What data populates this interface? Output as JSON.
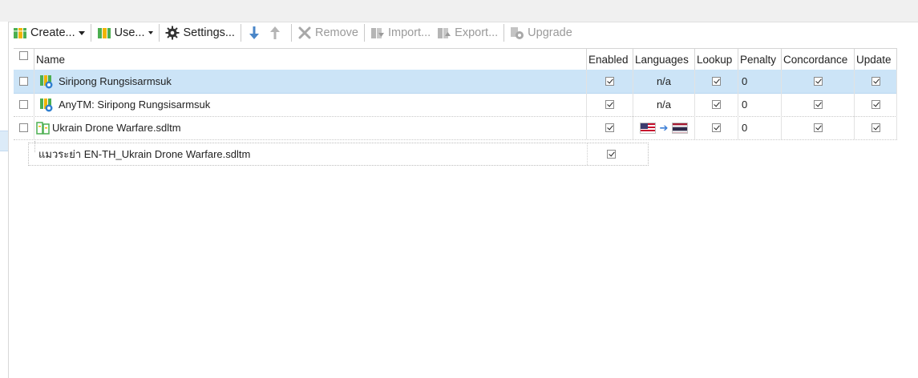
{
  "toolbar": {
    "create_label": "Create...",
    "use_label": "Use...",
    "settings_label": "Settings...",
    "remove_label": "Remove",
    "import_label": "Import...",
    "export_label": "Export...",
    "upgrade_label": "Upgrade"
  },
  "grid": {
    "columns": [
      "Name",
      "Enabled",
      "Languages",
      "Lookup",
      "Penalty",
      "Concordance",
      "Update"
    ],
    "rows": [
      {
        "name": "Siripong Rungsisarmsuk",
        "enabled": true,
        "languages": "n/a",
        "lookup": true,
        "penalty": "0",
        "concordance": true,
        "update": true,
        "selected": true,
        "icon": "server-tm-icon"
      },
      {
        "name": "AnyTM: Siripong Rungsisarmsuk",
        "enabled": true,
        "languages": "n/a",
        "lookup": true,
        "penalty": "0",
        "concordance": true,
        "update": true,
        "selected": false,
        "icon": "server-tm-icon"
      },
      {
        "name": "Ukrain Drone Warfare.sdltm",
        "enabled": true,
        "languages": "",
        "source_flag": "us-flag-icon",
        "target_flag": "thailand-flag-icon",
        "lookup": true,
        "penalty": "0",
        "concordance": true,
        "update": true,
        "selected": false,
        "icon": "file-tm-icon"
      }
    ],
    "sub_row": {
      "name": "แมวระย่า EN-TH_Ukrain Drone Warfare.sdltm",
      "enabled": true
    }
  },
  "colors": {
    "selection": "#cce4f7",
    "toolbar_bg": "#f0f0f0",
    "accent": "#3b7ed6"
  }
}
